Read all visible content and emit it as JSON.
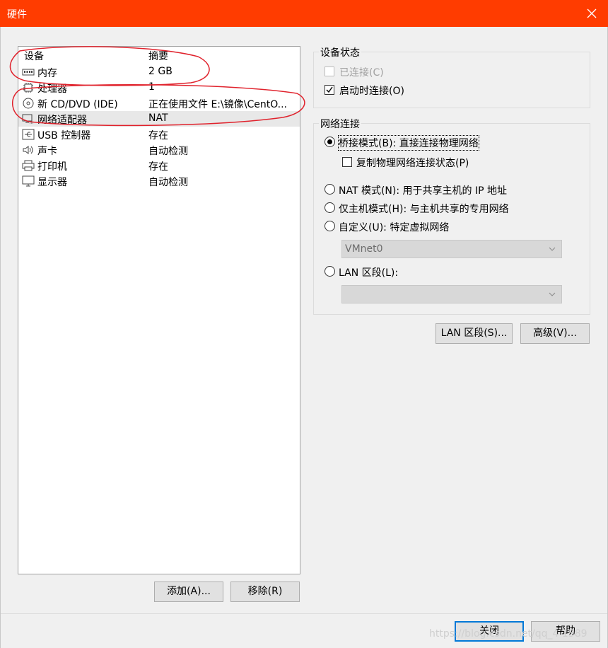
{
  "window": {
    "title": "硬件"
  },
  "device_list": {
    "headers": {
      "device": "设备",
      "summary": "摘要"
    },
    "rows": [
      {
        "name": "内存",
        "summary": "2 GB",
        "icon": "memory-icon"
      },
      {
        "name": "处理器",
        "summary": "1",
        "icon": "processor-icon"
      },
      {
        "name": "新 CD/DVD (IDE)",
        "summary": "正在使用文件 E:\\镜像\\CentO...",
        "icon": "cd-dvd-icon"
      },
      {
        "name": "网络适配器",
        "summary": "NAT",
        "icon": "network-adapter-icon"
      },
      {
        "name": "USB 控制器",
        "summary": "存在",
        "icon": "usb-icon"
      },
      {
        "name": "声卡",
        "summary": "自动检测",
        "icon": "sound-icon"
      },
      {
        "name": "打印机",
        "summary": "存在",
        "icon": "printer-icon"
      },
      {
        "name": "显示器",
        "summary": "自动检测",
        "icon": "display-icon"
      }
    ],
    "selected_index": 3
  },
  "device_buttons": {
    "add": "添加(A)...",
    "remove": "移除(R)"
  },
  "device_status": {
    "label": "设备状态",
    "connected": {
      "label": "已连接(C)",
      "checked": false,
      "disabled": true
    },
    "connect_at_power_on": {
      "label": "启动时连接(O)",
      "checked": true
    }
  },
  "network_connection": {
    "label": "网络连接",
    "bridged": {
      "label": "桥接模式(B): 直接连接物理网络",
      "selected": true
    },
    "replicate": {
      "label": "复制物理网络连接状态(P)",
      "checked": false
    },
    "nat": {
      "label": "NAT 模式(N): 用于共享主机的 IP 地址",
      "selected": false
    },
    "host_only": {
      "label": "仅主机模式(H): 与主机共享的专用网络",
      "selected": false
    },
    "custom": {
      "label": "自定义(U): 特定虚拟网络",
      "selected": false
    },
    "custom_network": {
      "value": "VMnet0"
    },
    "lan_segment": {
      "label": "LAN 区段(L):",
      "selected": false
    },
    "lan_segment_select": {
      "value": ""
    }
  },
  "adapter_buttons": {
    "lan_segments": "LAN 区段(S)...",
    "advanced": "高级(V)..."
  },
  "dialog_buttons": {
    "close": "关闭",
    "help": "帮助"
  },
  "watermark": "https://blog.csdn.net/qq_4   1589",
  "colors": {
    "titlebar": "#ff3c00",
    "annotation": "#e0222c",
    "focus_border": "#0078d7"
  }
}
